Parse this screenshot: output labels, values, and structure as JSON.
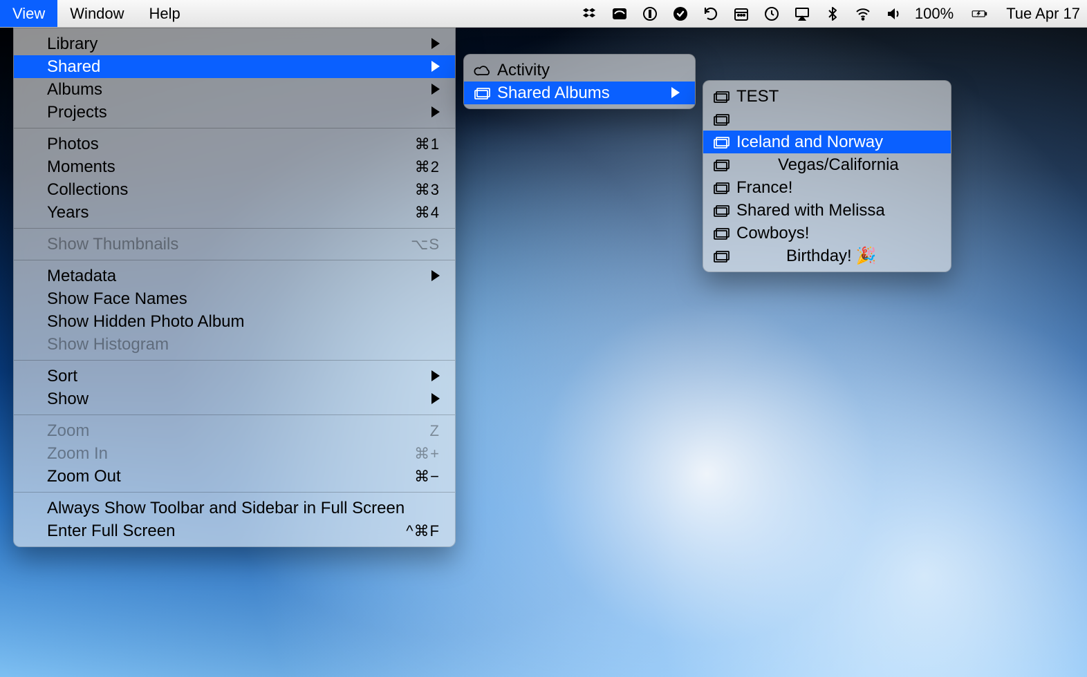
{
  "menubar": {
    "titles": {
      "view": "View",
      "window": "Window",
      "help": "Help"
    },
    "status": {
      "battery": "100%",
      "clock": "Tue Apr 17"
    }
  },
  "viewMenu": {
    "library": "Library",
    "shared": "Shared",
    "albums": "Albums",
    "projects": "Projects",
    "photos": {
      "label": "Photos",
      "shortcut": "⌘1"
    },
    "moments": {
      "label": "Moments",
      "shortcut": "⌘2"
    },
    "collections": {
      "label": "Collections",
      "shortcut": "⌘3"
    },
    "years": {
      "label": "Years",
      "shortcut": "⌘4"
    },
    "showThumbnails": {
      "label": "Show Thumbnails",
      "shortcut": "⌥S"
    },
    "metadata": "Metadata",
    "showFaceNames": "Show Face Names",
    "showHiddenPhotoAlbum": "Show Hidden Photo Album",
    "showHistogram": "Show Histogram",
    "sort": "Sort",
    "show": "Show",
    "zoom": {
      "label": "Zoom",
      "shortcut": "Z"
    },
    "zoomIn": {
      "label": "Zoom In",
      "shortcut": "⌘+"
    },
    "zoomOut": {
      "label": "Zoom Out",
      "shortcut": "⌘−"
    },
    "alwaysToolbar": "Always Show Toolbar and Sidebar in Full Screen",
    "enterFullScreen": {
      "label": "Enter Full Screen",
      "shortcut": "^⌘F"
    }
  },
  "sharedMenu": {
    "activity": "Activity",
    "sharedAlbums": "Shared Albums"
  },
  "albumsMenu": {
    "items": [
      {
        "label": "TEST"
      },
      {
        "label": ""
      },
      {
        "label": "Iceland and Norway",
        "highlighted": true
      },
      {
        "label": "Vegas/California",
        "indent": true
      },
      {
        "label": "France!"
      },
      {
        "label": "Shared with Melissa"
      },
      {
        "label": "Cowboys!"
      },
      {
        "label": "Birthday!",
        "indent": true,
        "emoji": "🎉"
      }
    ]
  }
}
